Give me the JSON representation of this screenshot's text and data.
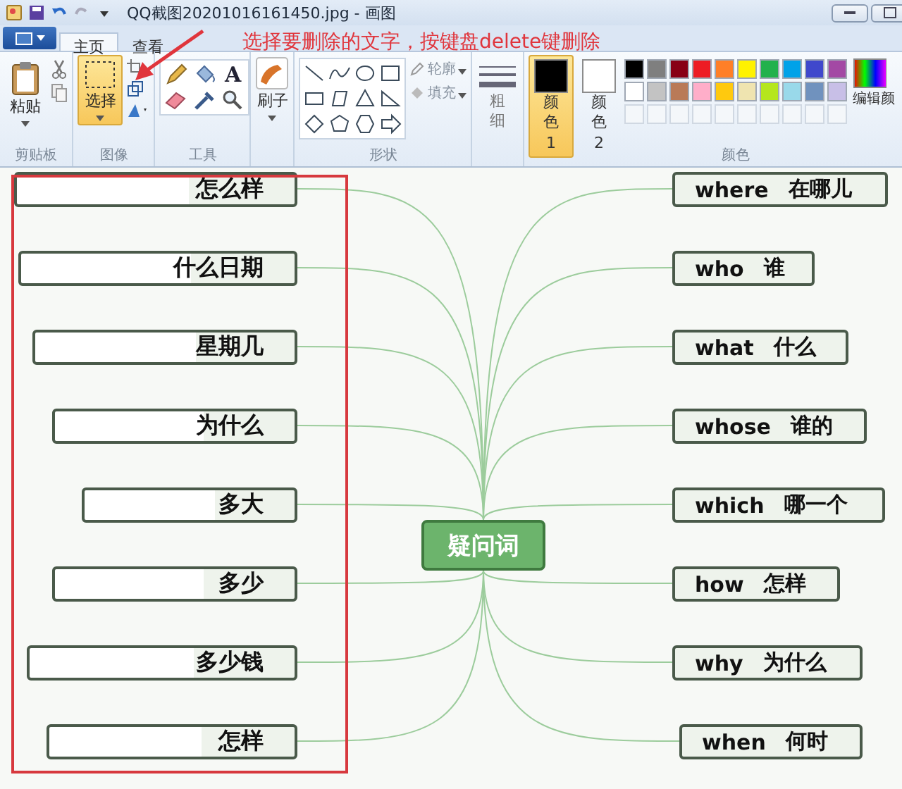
{
  "window": {
    "title": "QQ截图20201016161450.jpg - 画图"
  },
  "tabs": [
    {
      "label": "主页",
      "selected": true
    },
    {
      "label": "查看",
      "selected": false
    }
  ],
  "clipboard": {
    "paste": "粘贴",
    "label": "剪贴板"
  },
  "image": {
    "select": {
      "label": "选择",
      "selected": true
    },
    "label": "图像"
  },
  "tools": {
    "text_glyph": "A",
    "label": "工具"
  },
  "brushes": {
    "label": "刷子"
  },
  "shapes": {
    "outline": "轮廓",
    "fill": "填充",
    "label": "形状"
  },
  "size": {
    "label": "粗细"
  },
  "colors": {
    "color1": {
      "label": "颜色 1",
      "selected": true,
      "color": "#000000"
    },
    "color2": {
      "label": "颜色 2",
      "selected": false,
      "color": "#ffffff"
    },
    "palette": [
      {
        "color": "#000000"
      },
      {
        "color": "#7f7f7f"
      },
      {
        "color": "#880015"
      },
      {
        "color": "#ed1c24"
      },
      {
        "color": "#ff7f27"
      },
      {
        "color": "#fff200"
      },
      {
        "color": "#22b14c"
      },
      {
        "color": "#00a2e8"
      },
      {
        "color": "#3f48cc"
      },
      {
        "color": "#a349a4"
      },
      {
        "color": "#ffffff"
      },
      {
        "color": "#c3c3c3"
      },
      {
        "color": "#b97a57"
      },
      {
        "color": "#ffaec9"
      },
      {
        "color": "#ffc90e"
      },
      {
        "color": "#efe4b0"
      },
      {
        "color": "#b5e61d"
      },
      {
        "color": "#99d9ea"
      },
      {
        "color": "#7092be"
      },
      {
        "color": "#c8bfe7"
      }
    ],
    "edit": "编辑颜",
    "label": "颜色"
  },
  "annotation": {
    "text": "选择要删除的文字，按键盘delete键删除"
  },
  "mindmap": {
    "center": "疑问词",
    "left": [
      "怎么样",
      "什么日期",
      "星期几",
      "为什么",
      "多大",
      "多少",
      "多少钱",
      "怎样"
    ],
    "right": [
      {
        "en": "where",
        "zh": "在哪儿"
      },
      {
        "en": "who",
        "zh": "谁"
      },
      {
        "en": "what",
        "zh": "什么"
      },
      {
        "en": "whose",
        "zh": "谁的"
      },
      {
        "en": "which",
        "zh": "哪一个"
      },
      {
        "en": "how",
        "zh": "怎样"
      },
      {
        "en": "why",
        "zh": "为什么"
      },
      {
        "en": "when",
        "zh": "何时"
      }
    ]
  }
}
